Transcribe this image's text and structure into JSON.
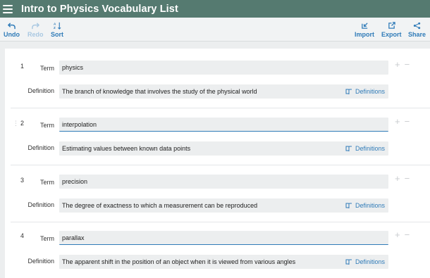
{
  "app": {
    "title": "Intro to Physics Vocabulary List"
  },
  "toolbar": {
    "undo": "Undo",
    "redo": "Redo",
    "sort": "Sort",
    "import": "Import",
    "export": "Export",
    "share": "Share"
  },
  "labels": {
    "term": "Term",
    "definition": "Definition",
    "definitions_button": "Definitions"
  },
  "items": [
    {
      "number": "1",
      "term": "physics",
      "definition": "The branch of knowledge that involves the study of the physical world"
    },
    {
      "number": "2",
      "term": "interpolation",
      "definition": "Estimating values between known data points"
    },
    {
      "number": "3",
      "term": "precision",
      "definition": "The degree of exactness to which a measurement can be reproduced"
    },
    {
      "number": "4",
      "term": "parallax",
      "definition": "The apparent shift in the position of an object when it is viewed from various angles"
    }
  ],
  "icons": {
    "menu": "hamburger-icon",
    "undo": "undo-arrow-icon",
    "redo": "redo-arrow-icon",
    "sort": "sort-icon",
    "import": "import-icon",
    "export": "export-icon",
    "share": "share-icon",
    "definitions": "book-icon",
    "add": "plus-icon",
    "remove": "minus-icon",
    "drag": "drag-handle-icon"
  },
  "colors": {
    "header": "#557a70",
    "accent": "#2f7bb8"
  }
}
